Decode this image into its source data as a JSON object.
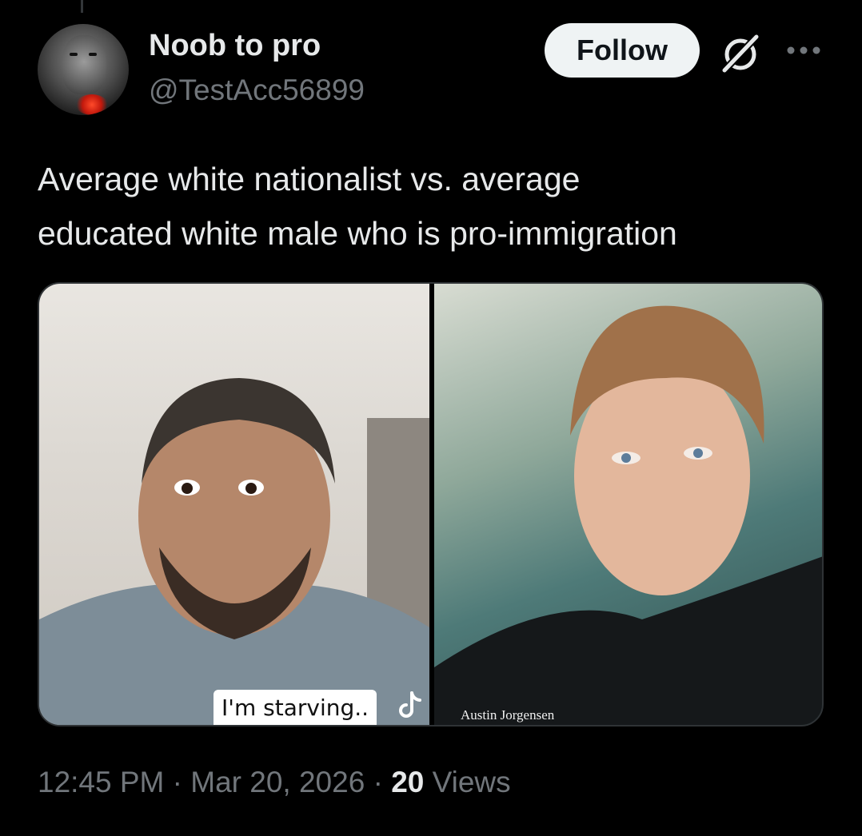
{
  "author": {
    "display_name": "Noob to pro",
    "handle": "@TestAcc56899"
  },
  "actions": {
    "follow_label": "Follow",
    "grok_icon": "grok-icon",
    "more_icon": "more-options-icon"
  },
  "tweet": {
    "text": "Average white nationalist vs. average\neducated white male who is pro-immigration"
  },
  "media": {
    "left_caption": "I'm starving..",
    "right_caption": "Austin Jorgensen"
  },
  "meta": {
    "time": "12:45 PM",
    "separator": " · ",
    "date": "Mar 20, 2026",
    "views_count": "20",
    "views_label": "Views"
  },
  "colors": {
    "background": "#000000",
    "text_primary": "#e7e9ea",
    "text_secondary": "#71767b",
    "follow_bg": "#eff3f4"
  }
}
